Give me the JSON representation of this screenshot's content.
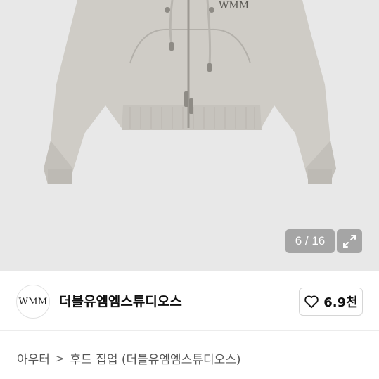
{
  "image": {
    "counter": "6 / 16",
    "brand_print": "WMM",
    "background": "#e8e8e8"
  },
  "shop": {
    "logo_text": "WMM",
    "name": "더블유엠엠스튜디오스",
    "follow_count": "6.9천"
  },
  "breadcrumb": {
    "level1": "아우터",
    "separator": ">",
    "level2": "후드 집업 (더블유엠엠스튜디오스)"
  },
  "icons": [
    "heart-outline-icon",
    "expand-icon"
  ]
}
